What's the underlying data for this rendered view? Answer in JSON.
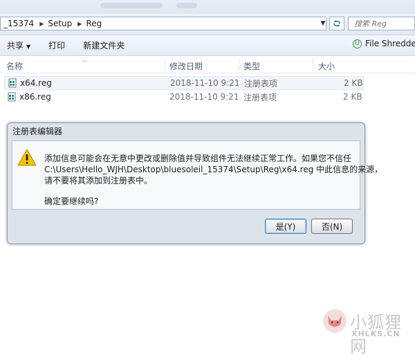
{
  "address": {
    "crumbs": [
      "_15374",
      "Setup",
      "Reg"
    ]
  },
  "search": {
    "placeholder": "搜索 Reg"
  },
  "toolbar": {
    "share": "共享",
    "print": "打印",
    "new_folder": "新建文件夹",
    "file_shredder": "File Shredder"
  },
  "columns": {
    "name": "名称",
    "modified": "修改日期",
    "type": "类型",
    "size": "大小"
  },
  "files": [
    {
      "name": "x64.reg",
      "modified": "2018-11-10 9:21",
      "type": "注册表项",
      "size": "2 KB"
    },
    {
      "name": "x86.reg",
      "modified": "2018-11-10 9:21",
      "type": "注册表项",
      "size": "2 KB"
    }
  ],
  "dialog": {
    "title": "注册表编辑器",
    "line1": "添加信息可能会在无意中更改或删除值并导致组件无法继续正常工作。如果您不信任",
    "line2": "C:\\Users\\Hello_WJH\\Desktop\\bluesoleil_15374\\Setup\\Reg\\x64.reg 中此信息的来源，",
    "line3": "请不要将其添加到注册表中。",
    "question": "确定要继续吗?",
    "yes_label": "是(Y)",
    "no_label": "否(N)"
  },
  "watermark": {
    "cn": "小狐狸网",
    "en": "XHLKS.CN"
  },
  "colors": {
    "accent": "#3c7fb1",
    "warning": "#f2c500",
    "selection": "#f1f4f8"
  }
}
